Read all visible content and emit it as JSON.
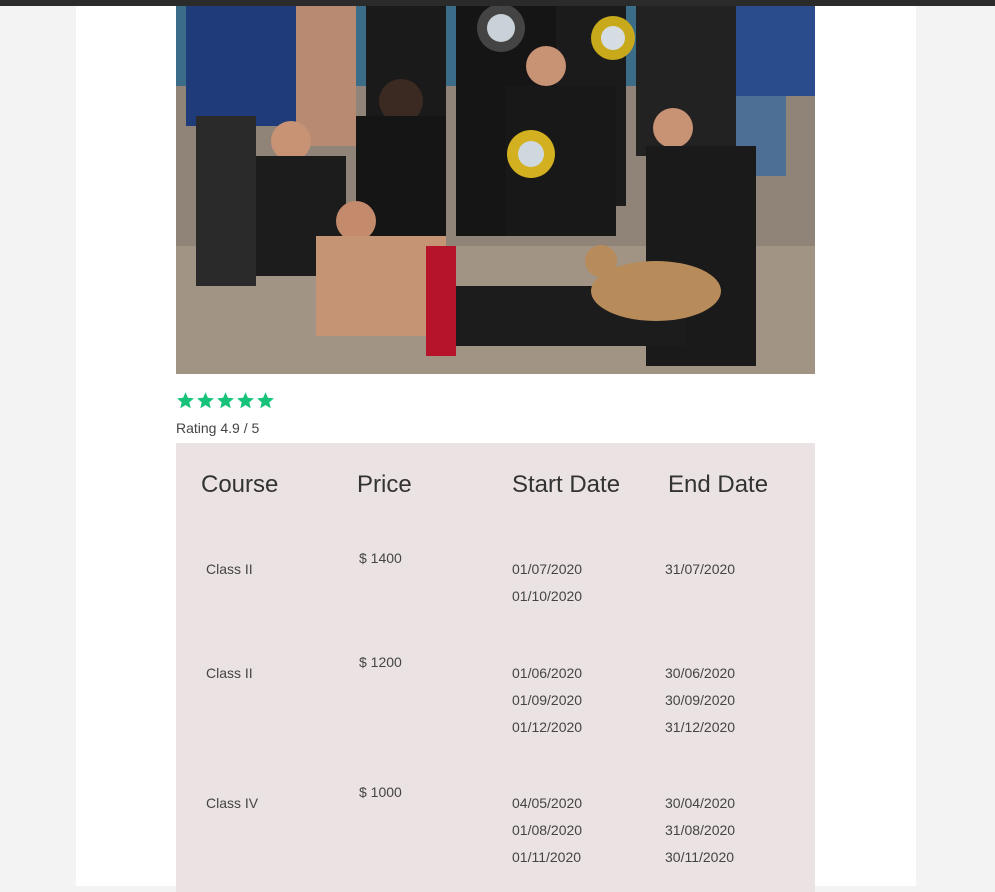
{
  "rating": {
    "stars": 5,
    "text": "Rating 4.9 / 5"
  },
  "colors": {
    "star": "#17c37b",
    "panel": "#ebe3e3",
    "page_bg": "#f4f3f3"
  },
  "table": {
    "headers": [
      "Course",
      "Price",
      "Start Date",
      "End Date"
    ],
    "rows": [
      {
        "course": "Class II",
        "price": "$ 1400",
        "start": [
          "01/07/2020",
          "01/10/2020"
        ],
        "end": [
          "31/07/2020"
        ]
      },
      {
        "course": "Class II",
        "price": "$ 1200",
        "start": [
          "01/06/2020",
          "01/09/2020",
          "01/12/2020"
        ],
        "end": [
          "30/06/2020",
          "30/09/2020",
          "31/12/2020"
        ]
      },
      {
        "course": "Class IV",
        "price": "$ 1000",
        "start": [
          "04/05/2020",
          "01/08/2020",
          "01/11/2020"
        ],
        "end": [
          "30/04/2020",
          "31/08/2020",
          "30/11/2020"
        ]
      }
    ]
  }
}
